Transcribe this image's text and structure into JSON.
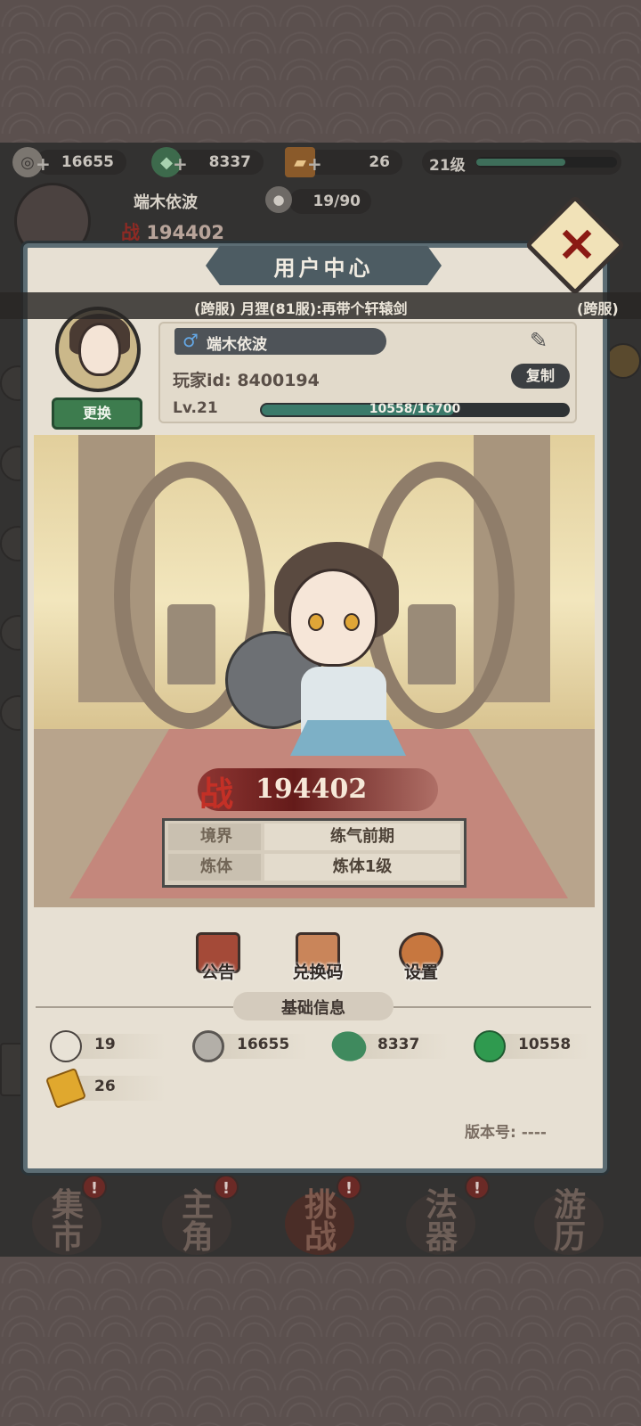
{
  "top_resources": {
    "coins": "16655",
    "jade": "8337",
    "tickets": "26",
    "level": "21级",
    "level_progress": 0.63
  },
  "background_hud": {
    "player_name": "端木依波",
    "energy": "19/90",
    "power_glyph": "战",
    "power": "194402"
  },
  "modal": {
    "title": "用户中心",
    "close_label": "✕"
  },
  "marquee": {
    "message": "(跨服) 月狸(81服):再带个轩辕剑",
    "tail": "(跨服)"
  },
  "profile": {
    "gender_symbol": "♂",
    "name": "端木依波",
    "player_id": "玩家id: 8400194",
    "change_button": "更换",
    "copy_button": "复制",
    "level": "Lv.21",
    "exp_text": "10558/16700",
    "exp_progress": 0.632
  },
  "character": {
    "power_glyph": "战",
    "power": "194402",
    "realm_label": "境界",
    "realm_value": "练气前期",
    "body_label": "炼体",
    "body_value": "炼体1级"
  },
  "actions": {
    "notice": "公告",
    "redeem": "兑换码",
    "settings": "设置"
  },
  "basic_info": {
    "title": "基础信息",
    "buns": "19",
    "coins": "16655",
    "jade": "8337",
    "exp_orb": "10558",
    "tickets": "26"
  },
  "version": "版本号: ----",
  "bottom_nav": [
    {
      "label": "集市",
      "badge": "!"
    },
    {
      "label": "主角",
      "badge": "!"
    },
    {
      "label": "挑战",
      "badge": "!"
    },
    {
      "label": "法器",
      "badge": "!"
    },
    {
      "label": "游历",
      "badge": "!"
    }
  ],
  "colors": {
    "modal_bg": "#e7e0d3",
    "modal_border": "#5c6d74",
    "accent_green": "#3d7c4e",
    "power_red": "#c33026"
  }
}
